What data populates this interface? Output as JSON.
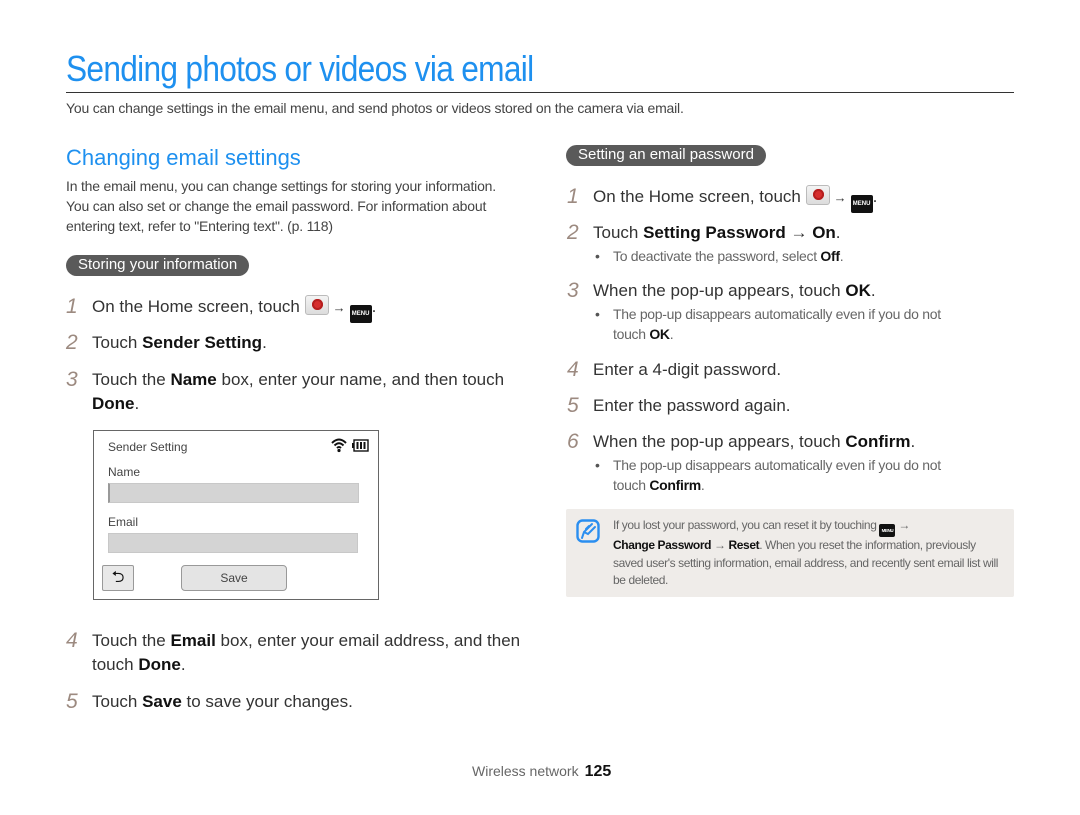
{
  "page": {
    "title": "Sending photos or videos via email",
    "intro": "You can change settings in the email menu, and send photos or videos stored on the camera via email."
  },
  "section": {
    "heading": "Changing email settings",
    "paragraph": "In the email menu, you can change settings for storing your information. You can also set or change the email password. For information about entering text, refer to \"Entering text\". (p. 118)"
  },
  "left": {
    "pill": "Storing your information",
    "steps": [
      {
        "num": "1",
        "pre": "On the Home screen, touch ",
        "post": "."
      },
      {
        "num": "2",
        "pre": "Touch ",
        "bold": "Sender Setting",
        "post": "."
      },
      {
        "num": "3",
        "pre": "Touch the ",
        "bold": "Name",
        "mid": " box, enter your name, and then touch",
        "bold2": "Done",
        "post": "."
      },
      {
        "num": "4",
        "pre": "Touch the ",
        "bold": "Email",
        "mid": " box, enter your email address, and then",
        "line2": "touch ",
        "bold2": "Done",
        "post": "."
      },
      {
        "num": "5",
        "pre": "Touch ",
        "bold": "Save",
        "post": " to save your changes."
      }
    ],
    "screen": {
      "title": "Sender Setting",
      "name_label": "Name",
      "name_value": "",
      "email_label": "Email",
      "email_value": "",
      "back_icon": "back-arrow-icon",
      "save_label": "Save",
      "status_icons": [
        "wifi-icon",
        "battery-icon"
      ]
    }
  },
  "right": {
    "pill": "Setting an email password",
    "steps": [
      {
        "num": "1",
        "pre": "On the Home screen, touch ",
        "post": "."
      },
      {
        "num": "2",
        "pre": "Touch ",
        "bold": "Setting Password",
        "arrow": " → ",
        "bold2": "On",
        "post": ".",
        "bullet": {
          "pre": "To deactivate the password, select ",
          "bold": "Off",
          "post": "."
        }
      },
      {
        "num": "3",
        "pre": "When the pop-up appears, touch ",
        "bold": "OK",
        "post": ".",
        "bullet": {
          "pre": "The pop-up disappears automatically even if you do not",
          "line2": "touch ",
          "bold": "OK",
          "post": "."
        }
      },
      {
        "num": "4",
        "pre": "Enter a 4-digit password."
      },
      {
        "num": "5",
        "pre": "Enter the password again."
      },
      {
        "num": "6",
        "pre": "When the pop-up appears, touch ",
        "bold": "Confirm",
        "post": ".",
        "bullet": {
          "pre": "The pop-up disappears automatically even if you do not",
          "line2": "touch ",
          "bold": "Confirm",
          "post": "."
        }
      }
    ],
    "note": {
      "icon": "note-pencil-icon",
      "line1": "If you lost your password, you can reset it by touching ",
      "bold1": "Change Password",
      "arrow": " → ",
      "bold2": "Reset",
      "rest": ". When you reset the information, previously saved user's setting information, email address, and recently sent email list will be deleted."
    }
  },
  "icons": {
    "mail_app": "email-app-icon",
    "menu": "MENU",
    "arrow": "→"
  },
  "footer": {
    "section": "Wireless network",
    "page_number": "125"
  }
}
